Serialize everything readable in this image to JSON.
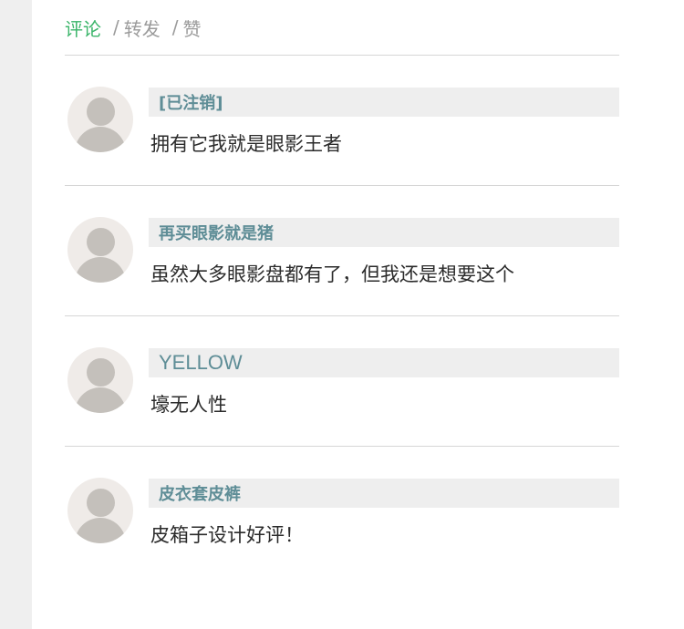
{
  "tabs": [
    {
      "label": "评论",
      "active": true
    },
    {
      "label": "转发",
      "active": false
    },
    {
      "label": "赞",
      "active": false
    }
  ],
  "separator": "/",
  "comments": [
    {
      "user": "[已注销]",
      "text": "拥有它我就是眼影王者"
    },
    {
      "user": "再买眼影就是猪",
      "text": "虽然大多眼影盘都有了，但我还是想要这个"
    },
    {
      "user": "YELLOW",
      "text": "壕无人性"
    },
    {
      "user": "皮衣套皮裤",
      "text": "皮箱子设计好评！"
    }
  ],
  "colors": {
    "active_tab": "#3bb56a",
    "inactive_tab": "#9b9b9b",
    "username": "#5e8d96",
    "username_bg": "#eeeeee",
    "text": "#2b2b2b",
    "divider": "#d6d6d6",
    "avatar": "#c4c0bb"
  },
  "icons": {
    "avatar": "default-user-avatar-icon"
  }
}
